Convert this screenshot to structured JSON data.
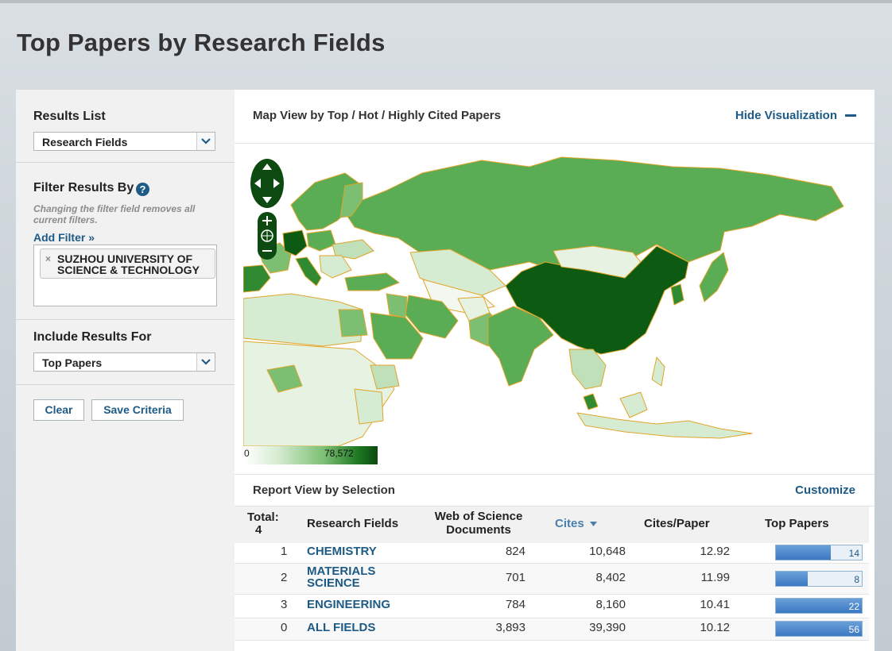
{
  "page": {
    "title": "Top Papers by Research Fields"
  },
  "sidebar": {
    "results_list": {
      "label": "Results List",
      "selected": "Research Fields"
    },
    "filter": {
      "label": "Filter Results By",
      "help_icon": "question-icon",
      "hint": "Changing the filter field removes all current filters.",
      "add_filter": "Add Filter »",
      "chips": [
        {
          "text": "SUZHOU UNIVERSITY OF SCIENCE & TECHNOLOGY",
          "remove": "×"
        }
      ]
    },
    "include": {
      "label": "Include Results For",
      "selected": "Top Papers"
    },
    "buttons": {
      "clear": "Clear",
      "save": "Save Criteria"
    }
  },
  "map": {
    "title": "Map View by Top / Hot / Highly Cited Papers",
    "hide": "Hide Visualization",
    "legend_min": "0",
    "legend_max": "78,572",
    "colors": {
      "low": "#e6f3e3",
      "mid": "#5aac55",
      "high": "#0d5a13",
      "border": "#e0a52a"
    }
  },
  "report": {
    "title": "Report View by Selection",
    "customize": "Customize",
    "columns": {
      "total_label": "Total:",
      "total_value": "4",
      "field": "Research Fields",
      "docs": "Web of Science Documents",
      "cites": "Cites",
      "cites_per_paper": "Cites/Paper",
      "top": "Top Papers"
    },
    "rows": [
      {
        "rank": "1",
        "field": "CHEMISTRY",
        "docs": "824",
        "cites": "10,648",
        "cpp": "12.92",
        "top": "14",
        "top_fraction": 0.64
      },
      {
        "rank": "2",
        "field": "MATERIALS SCIENCE",
        "docs": "701",
        "cites": "8,402",
        "cpp": "11.99",
        "top": "8",
        "top_fraction": 0.37
      },
      {
        "rank": "3",
        "field": "ENGINEERING",
        "docs": "784",
        "cites": "8,160",
        "cpp": "10.41",
        "top": "22",
        "top_fraction": 1.0
      },
      {
        "rank": "0",
        "field": "ALL FIELDS",
        "docs": "3,893",
        "cites": "39,390",
        "cpp": "10.12",
        "top": "56",
        "top_fraction": 1.0
      }
    ]
  }
}
